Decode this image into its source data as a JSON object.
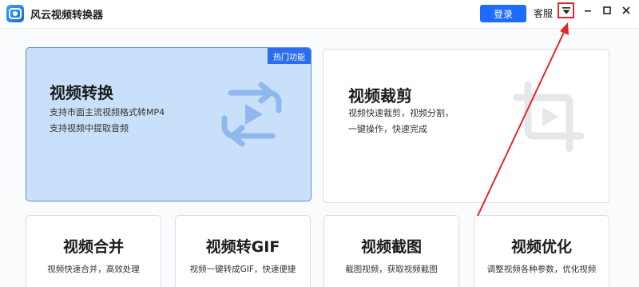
{
  "app": {
    "title": "风云视频转换器",
    "accent_color": "#1f6bff"
  },
  "header": {
    "login_label": "登录",
    "service_label": "客服",
    "menu_icon": "dropdown-menu-icon",
    "window_controls": [
      "minimize-icon",
      "maximize-icon",
      "close-icon"
    ]
  },
  "cards": {
    "convert": {
      "title": "视频转换",
      "badge": "热门功能",
      "desc1": "支持市面主流视频格式转MP4",
      "desc2": "支持视频中提取音频",
      "icon": "convert-play-icon"
    },
    "crop": {
      "title": "视频裁剪",
      "desc1": "视频快速裁剪，视频分割，",
      "desc2": "一键操作，快速完成",
      "icon": "crop-play-icon"
    },
    "merge": {
      "title": "视频合并",
      "desc": "视频快速合并，高效处理"
    },
    "gif": {
      "title": "视频转GIF",
      "desc": "视频一键转成GIF，快速便捷"
    },
    "screenshot": {
      "title": "视频截图",
      "desc": "截图视频，获取视频截图"
    },
    "optimize": {
      "title": "视频优化",
      "desc": "调整视频各种参数，优化视频"
    }
  },
  "annotation": {
    "color": "#e0282b"
  }
}
